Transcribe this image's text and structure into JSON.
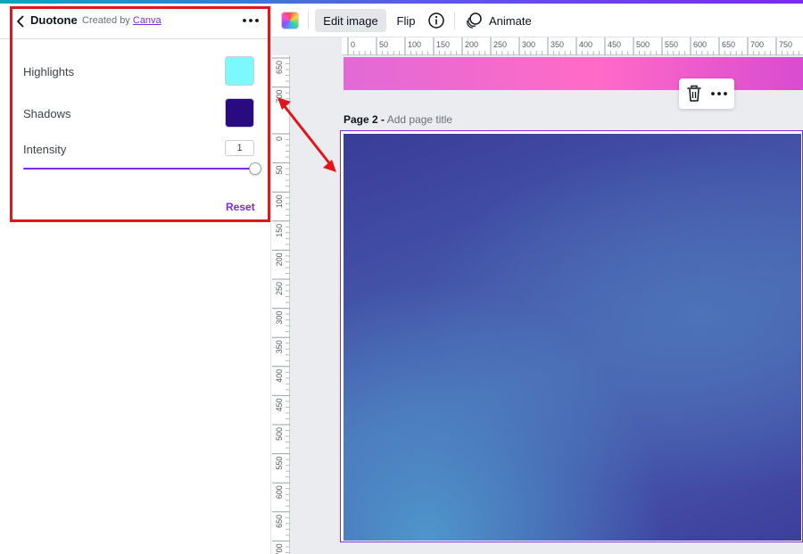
{
  "panel": {
    "title": "Duotone",
    "created_by_prefix": "Created by",
    "creator": "Canva",
    "highlights_label": "Highlights",
    "highlights_color": "#7cf9fb",
    "shadows_label": "Shadows",
    "shadows_color": "#2a0a80",
    "intensity_label": "Intensity",
    "intensity_value": "1",
    "intensity_fraction": 1.0,
    "reset_label": "Reset"
  },
  "toolbar": {
    "edit_image_label": "Edit image",
    "flip_label": "Flip",
    "animate_label": "Animate"
  },
  "canvas": {
    "page_label": "Page 2 -",
    "page_title_placeholder": "Add page title"
  },
  "rulers": {
    "top_ticks": [
      "0",
      "50",
      "100",
      "150",
      "200",
      "250",
      "300",
      "350",
      "400",
      "450",
      "500",
      "550",
      "600",
      "650",
      "700",
      "750"
    ],
    "left_ticks_upper": [
      "650",
      "700"
    ],
    "left_ticks_lower": [
      "0",
      "50",
      "100",
      "150",
      "200",
      "250",
      "300",
      "350",
      "400",
      "450",
      "500",
      "550",
      "600",
      "650",
      "700"
    ]
  },
  "colors": {
    "accent": "#7d2ae8",
    "annotation_red": "#e3151c"
  },
  "icons": {
    "back": "chevron-left-icon",
    "more": "more-horizontal-icon",
    "info": "info-icon",
    "animate": "animate-icon",
    "trash": "trash-icon"
  }
}
